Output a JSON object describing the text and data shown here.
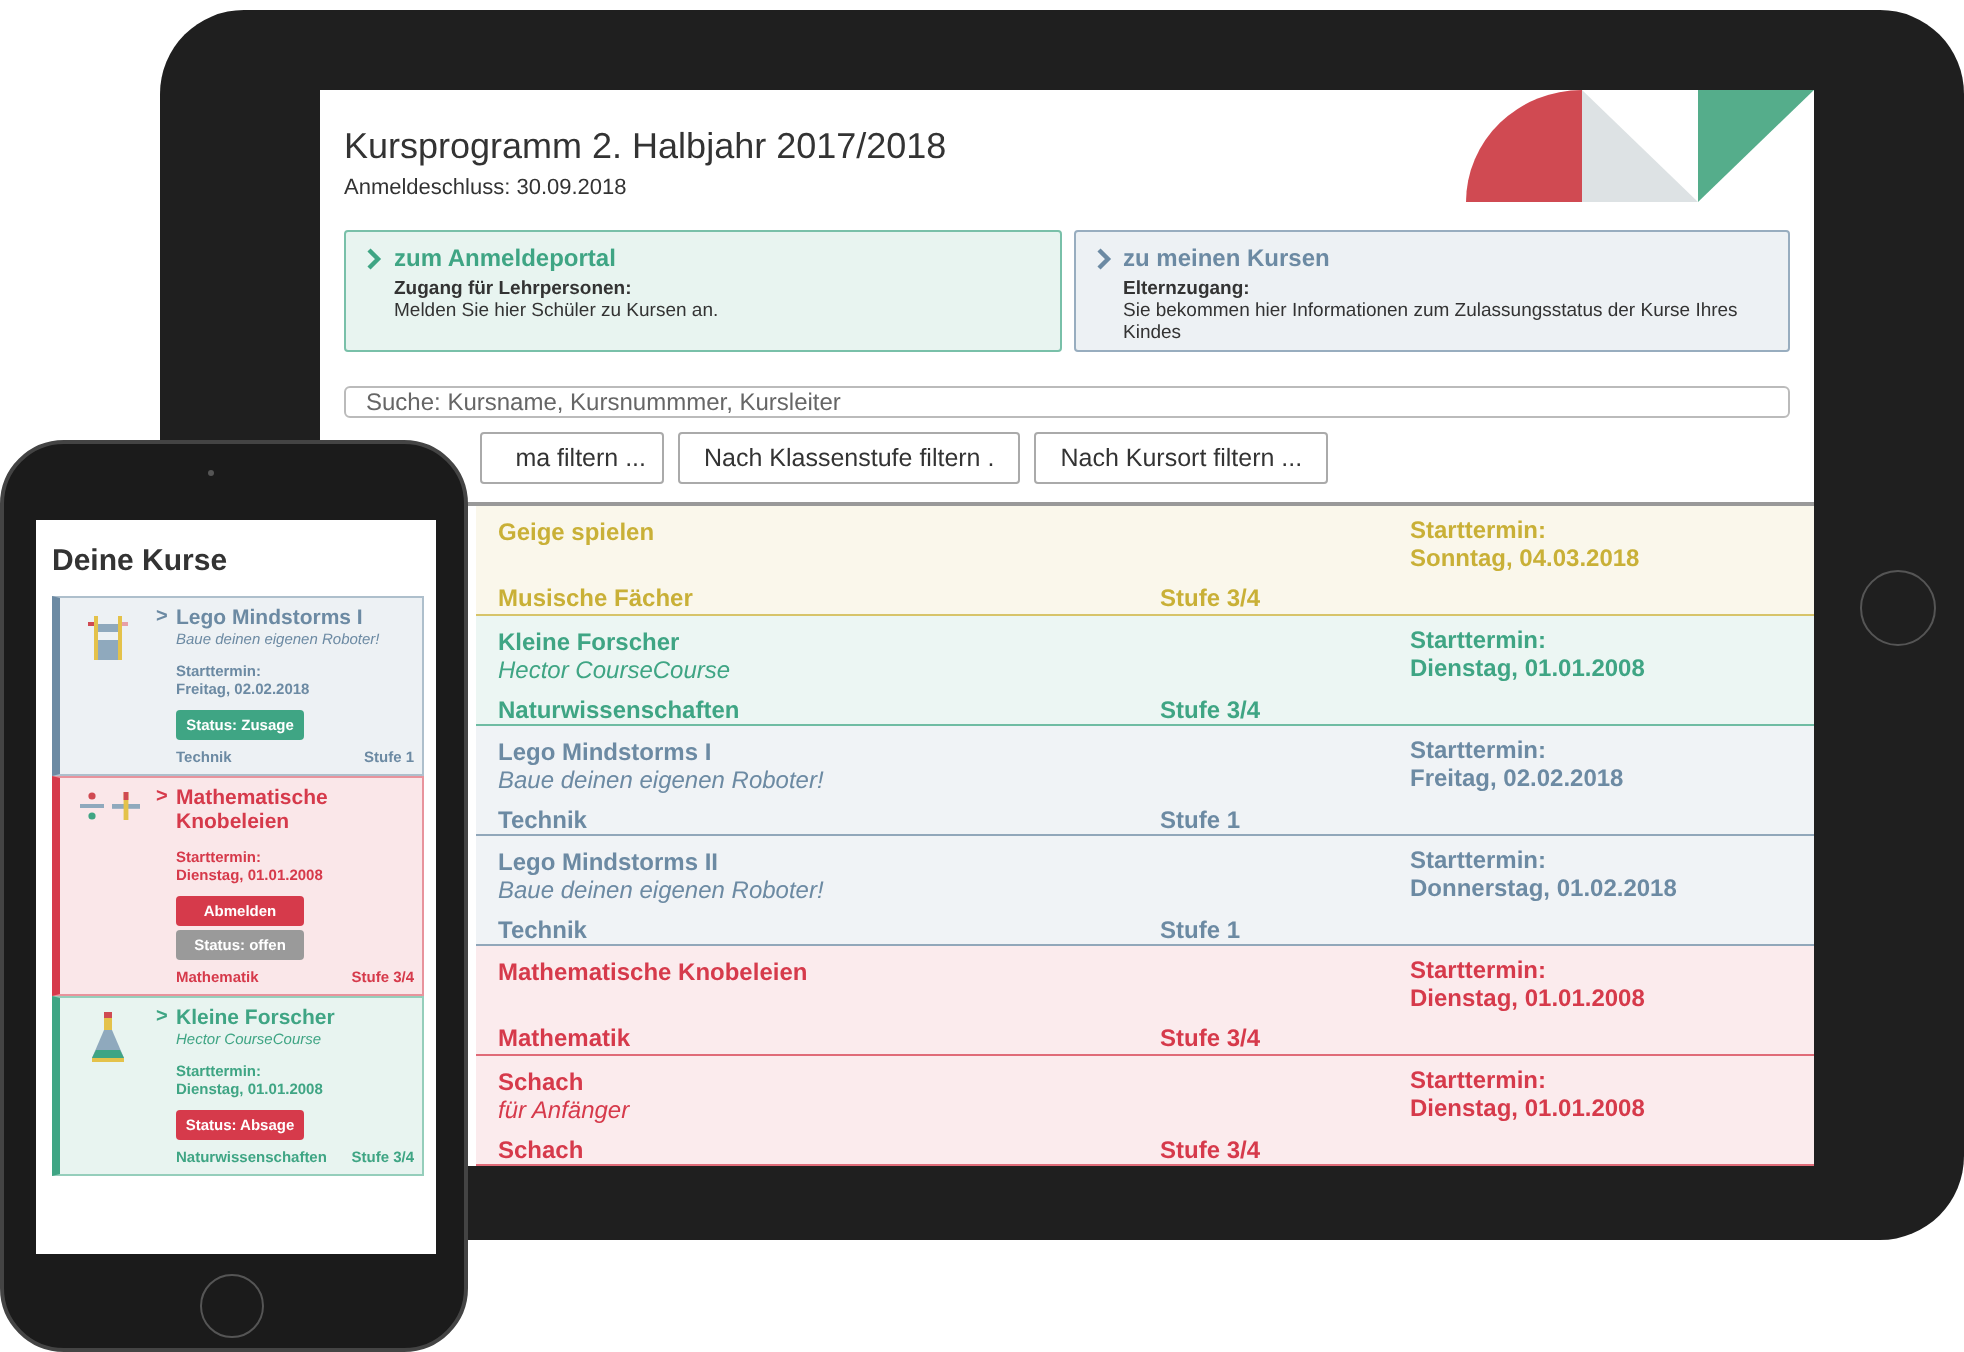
{
  "tablet": {
    "title": "Kursprogramm 2. Halbjahr 2017/2018",
    "deadline": "Anmeldeschluss: 30.09.2018",
    "portals": [
      {
        "link": "zum Anmeldeportal",
        "heading": "Zugang für Lehrpersonen:",
        "text": "Melden Sie hier Schüler zu Kursen an.",
        "color": "#3fa584"
      },
      {
        "link": "zu meinen Kursen",
        "heading": "Elternzugang:",
        "text": "Sie bekommen hier Informationen zum Zulassungsstatus der Kurse Ihres Kindes",
        "color": "#6c8aa3"
      }
    ],
    "search": {
      "placeholder": "Suche: Kursname, Kursnummmer, Kursleiter"
    },
    "filters": [
      "ma filtern ...",
      "Nach Klassenstufe filtern .",
      "Nach Kursort filtern ..."
    ],
    "courses": [
      {
        "title": "Geige spielen",
        "category": "Musische Fächer",
        "level": "Stufe 3/4",
        "start_label": "Starttermin:",
        "start_date": "Sonntag, 04.03.2018",
        "color": "#c9b037"
      },
      {
        "title": "Kleine Forscher",
        "subtitle": "Hector CourseCourse",
        "category": "Naturwissenschaften",
        "level": "Stufe 3/4",
        "start_label": "Starttermin:",
        "start_date": "Dienstag, 01.01.2008",
        "color": "#3fa584"
      },
      {
        "title": "Lego Mindstorms I",
        "subtitle": "Baue deinen eigenen Roboter!",
        "category": "Technik",
        "level": "Stufe 1",
        "start_label": "Starttermin:",
        "start_date": "Freitag, 02.02.2018",
        "color": "#6c8aa3"
      },
      {
        "title": "Lego Mindstorms II",
        "subtitle": "Baue deinen eigenen Roboter!",
        "category": "Technik",
        "level": "Stufe 1",
        "start_label": "Starttermin:",
        "start_date": "Donnerstag, 01.02.2018",
        "color": "#6c8aa3"
      },
      {
        "title": "Mathematische Knobeleien",
        "category": "Mathematik",
        "level": "Stufe 3/4",
        "start_label": "Starttermin:",
        "start_date": "Dienstag, 01.01.2008",
        "color": "#d63a4b"
      },
      {
        "title": "Schach",
        "subtitle": "für Anfänger",
        "category": "Schach",
        "level": "Stufe 3/4",
        "start_label": "Starttermin:",
        "start_date": "Dienstag, 01.01.2008",
        "color": "#d63a4b"
      }
    ]
  },
  "phone": {
    "title": "Deine Kurse",
    "courses": [
      {
        "kind": "robot",
        "chevron": ">",
        "title": "Lego Mindstorms I",
        "subtitle": "Baue deinen eigenen Roboter!",
        "start_label": "Starttermin:",
        "start_date": "Freitag, 02.02.2018",
        "buttons": [
          {
            "label": "Status: Zusage",
            "color": "#3fa584"
          }
        ],
        "category": "Technik",
        "level": "Stufe 1",
        "color": "#6c8aa3"
      },
      {
        "kind": "math",
        "chevron": ">",
        "title": "Mathematische Knobeleien",
        "start_label": "Starttermin:",
        "start_date": "Dienstag, 01.01.2008",
        "buttons": [
          {
            "label": "Abmelden",
            "color": "#d63a4b"
          },
          {
            "label": "Status: offen",
            "color": "#9a9a9a"
          }
        ],
        "category": "Mathematik",
        "level": "Stufe 3/4",
        "color": "#d63a4b"
      },
      {
        "kind": "flask",
        "chevron": ">",
        "title": "Kleine Forscher",
        "subtitle": "Hector CourseCourse",
        "start_label": "Starttermin:",
        "start_date": "Dienstag, 01.01.2008",
        "buttons": [
          {
            "label": "Status: Absage",
            "color": "#d63a4b"
          }
        ],
        "category": "Naturwissenschaften",
        "level": "Stufe 3/4",
        "color": "#3fa584"
      }
    ]
  }
}
